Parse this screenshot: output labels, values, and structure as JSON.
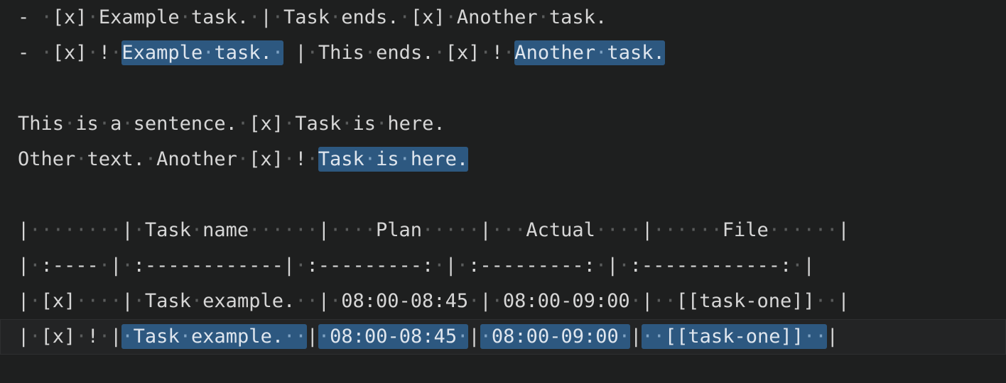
{
  "app": {
    "title": "Markdown Editor",
    "theme": "dark",
    "background_color": "#1e1f1f",
    "text_color": "#d6d6d6",
    "highlight_color": "#2d5880",
    "highlight_text_color": "#dfe6ee",
    "whitespace_dot_color": "#5a5c5c",
    "active_line_color": "#232425"
  },
  "document": {
    "lines": [
      {
        "index": 1,
        "name": "list-line-plain",
        "active": false,
        "segments": [
          {
            "type": "plain",
            "text": "- "
          },
          {
            "type": "ws"
          },
          {
            "type": "plain",
            "text": "[x]"
          },
          {
            "type": "ws"
          },
          {
            "type": "plain",
            "text": "Example"
          },
          {
            "type": "ws"
          },
          {
            "type": "plain",
            "text": "task."
          },
          {
            "type": "ws"
          },
          {
            "type": "plain",
            "text": "|"
          },
          {
            "type": "ws"
          },
          {
            "type": "plain",
            "text": "Task"
          },
          {
            "type": "ws"
          },
          {
            "type": "plain",
            "text": "ends."
          },
          {
            "type": "ws"
          },
          {
            "type": "plain",
            "text": "[x]"
          },
          {
            "type": "ws"
          },
          {
            "type": "plain",
            "text": "Another"
          },
          {
            "type": "ws"
          },
          {
            "type": "plain",
            "text": "task."
          }
        ]
      },
      {
        "index": 2,
        "name": "list-line-highlighted",
        "active": false,
        "segments": [
          {
            "type": "plain",
            "text": "- "
          },
          {
            "type": "ws"
          },
          {
            "type": "plain",
            "text": "[x]"
          },
          {
            "type": "ws"
          },
          {
            "type": "plain",
            "text": "!"
          },
          {
            "type": "ws"
          },
          {
            "type": "hl",
            "text": "Example task. "
          },
          {
            "type": "plain",
            "text": " "
          },
          {
            "type": "plain",
            "text": "|"
          },
          {
            "type": "ws"
          },
          {
            "type": "plain",
            "text": "This"
          },
          {
            "type": "ws"
          },
          {
            "type": "plain",
            "text": "ends."
          },
          {
            "type": "ws"
          },
          {
            "type": "plain",
            "text": "[x]"
          },
          {
            "type": "ws"
          },
          {
            "type": "plain",
            "text": "!"
          },
          {
            "type": "ws"
          },
          {
            "type": "hl",
            "text": "Another task."
          }
        ]
      },
      {
        "index": 3,
        "name": "blank-line",
        "active": false,
        "segments": []
      },
      {
        "index": 4,
        "name": "sentence-line-plain",
        "active": false,
        "segments": [
          {
            "type": "plain",
            "text": "This"
          },
          {
            "type": "ws"
          },
          {
            "type": "plain",
            "text": "is"
          },
          {
            "type": "ws"
          },
          {
            "type": "plain",
            "text": "a"
          },
          {
            "type": "ws"
          },
          {
            "type": "plain",
            "text": "sentence."
          },
          {
            "type": "ws"
          },
          {
            "type": "plain",
            "text": "[x]"
          },
          {
            "type": "ws"
          },
          {
            "type": "plain",
            "text": "Task"
          },
          {
            "type": "ws"
          },
          {
            "type": "plain",
            "text": "is"
          },
          {
            "type": "ws"
          },
          {
            "type": "plain",
            "text": "here."
          }
        ]
      },
      {
        "index": 5,
        "name": "sentence-line-highlighted",
        "active": false,
        "segments": [
          {
            "type": "plain",
            "text": "Other"
          },
          {
            "type": "ws"
          },
          {
            "type": "plain",
            "text": "text."
          },
          {
            "type": "ws"
          },
          {
            "type": "plain",
            "text": "Another"
          },
          {
            "type": "ws"
          },
          {
            "type": "plain",
            "text": "[x]"
          },
          {
            "type": "ws"
          },
          {
            "type": "plain",
            "text": "!"
          },
          {
            "type": "ws"
          },
          {
            "type": "hl",
            "text": "Task is here."
          }
        ]
      },
      {
        "index": 6,
        "name": "blank-line",
        "active": false,
        "segments": []
      },
      {
        "index": 7,
        "name": "table-header-row",
        "active": false,
        "segments": [
          {
            "type": "plain",
            "text": "|"
          },
          {
            "type": "ws",
            "count": 8
          },
          {
            "type": "plain",
            "text": "|"
          },
          {
            "type": "ws",
            "count": 1
          },
          {
            "type": "plain",
            "text": "Task"
          },
          {
            "type": "ws"
          },
          {
            "type": "plain",
            "text": "name"
          },
          {
            "type": "ws",
            "count": 6
          },
          {
            "type": "plain",
            "text": "|"
          },
          {
            "type": "ws",
            "count": 4
          },
          {
            "type": "plain",
            "text": "Plan"
          },
          {
            "type": "ws",
            "count": 5
          },
          {
            "type": "plain",
            "text": "|"
          },
          {
            "type": "ws",
            "count": 3
          },
          {
            "type": "plain",
            "text": "Actual"
          },
          {
            "type": "ws",
            "count": 4
          },
          {
            "type": "plain",
            "text": "|"
          },
          {
            "type": "ws",
            "count": 6
          },
          {
            "type": "plain",
            "text": "File"
          },
          {
            "type": "ws",
            "count": 6
          },
          {
            "type": "plain",
            "text": "|"
          }
        ]
      },
      {
        "index": 8,
        "name": "table-separator-row",
        "active": false,
        "segments": [
          {
            "type": "plain",
            "text": "|"
          },
          {
            "type": "ws",
            "count": 1
          },
          {
            "type": "plain",
            "text": ":----"
          },
          {
            "type": "ws",
            "count": 1
          },
          {
            "type": "plain",
            "text": "|"
          },
          {
            "type": "ws",
            "count": 1
          },
          {
            "type": "plain",
            "text": ":------------|"
          },
          {
            "type": "ws",
            "count": 1
          },
          {
            "type": "plain",
            "text": ":---------:"
          },
          {
            "type": "ws",
            "count": 1
          },
          {
            "type": "plain",
            "text": "|"
          },
          {
            "type": "ws",
            "count": 1
          },
          {
            "type": "plain",
            "text": ":---------:"
          },
          {
            "type": "ws",
            "count": 1
          },
          {
            "type": "plain",
            "text": "|"
          },
          {
            "type": "ws",
            "count": 1
          },
          {
            "type": "plain",
            "text": ":------------:"
          },
          {
            "type": "ws",
            "count": 1
          },
          {
            "type": "plain",
            "text": "|"
          }
        ]
      },
      {
        "index": 9,
        "name": "table-data-row-plain",
        "active": false,
        "segments": [
          {
            "type": "plain",
            "text": "|"
          },
          {
            "type": "ws",
            "count": 1
          },
          {
            "type": "plain",
            "text": "[x]"
          },
          {
            "type": "ws",
            "count": 4
          },
          {
            "type": "plain",
            "text": "|"
          },
          {
            "type": "ws",
            "count": 1
          },
          {
            "type": "plain",
            "text": "Task"
          },
          {
            "type": "ws"
          },
          {
            "type": "plain",
            "text": "example."
          },
          {
            "type": "ws",
            "count": 2
          },
          {
            "type": "plain",
            "text": "|"
          },
          {
            "type": "ws",
            "count": 1
          },
          {
            "type": "plain",
            "text": "08:00-08:45"
          },
          {
            "type": "ws",
            "count": 1
          },
          {
            "type": "plain",
            "text": "|"
          },
          {
            "type": "ws",
            "count": 1
          },
          {
            "type": "plain",
            "text": "08:00-09:00"
          },
          {
            "type": "ws",
            "count": 1
          },
          {
            "type": "plain",
            "text": "|"
          },
          {
            "type": "ws",
            "count": 2
          },
          {
            "type": "plain",
            "text": "[[task-one]]"
          },
          {
            "type": "ws",
            "count": 2
          },
          {
            "type": "plain",
            "text": "|"
          }
        ]
      },
      {
        "index": 10,
        "name": "table-data-row-highlighted",
        "active": true,
        "segments": [
          {
            "type": "plain",
            "text": "|"
          },
          {
            "type": "ws",
            "count": 1
          },
          {
            "type": "plain",
            "text": "[x]"
          },
          {
            "type": "ws",
            "count": 1
          },
          {
            "type": "plain",
            "text": "!"
          },
          {
            "type": "ws",
            "count": 1
          },
          {
            "type": "plain",
            "text": "|"
          },
          {
            "type": "hl",
            "text": " Task example.  "
          },
          {
            "type": "plain",
            "text": "|"
          },
          {
            "type": "hl",
            "text": " 08:00-08:45 "
          },
          {
            "type": "plain",
            "text": "|"
          },
          {
            "type": "hl",
            "text": " 08:00-09:00 "
          },
          {
            "type": "plain",
            "text": "|"
          },
          {
            "type": "hl",
            "text": "  [[task-one]]  "
          },
          {
            "type": "plain",
            "text": "|"
          }
        ]
      }
    ],
    "table": {
      "columns": [
        "",
        "Task name",
        "Plan",
        "Actual",
        "File"
      ],
      "alignments": [
        "left",
        "left",
        "center",
        "center",
        "center"
      ],
      "rows": [
        [
          "[x]",
          "Task example.",
          "08:00-08:45",
          "08:00-09:00",
          "[[task-one]]"
        ],
        [
          "[x] !",
          "Task example.",
          "08:00-08:45",
          "08:00-09:00",
          "[[task-one]]"
        ]
      ]
    }
  }
}
